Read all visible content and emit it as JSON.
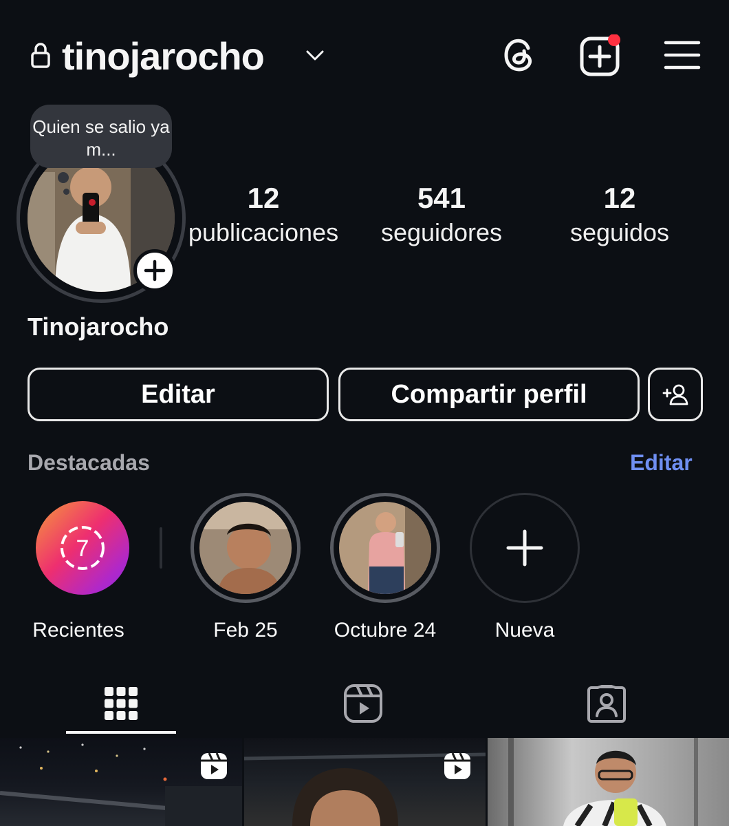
{
  "header": {
    "username": "tinojarocho",
    "icons": [
      "lock-icon",
      "chevron-down-icon",
      "threads-icon",
      "new-post-icon",
      "menu-icon"
    ],
    "notification_color": "#ff3040"
  },
  "profile": {
    "note": "Quien se salio ya m...",
    "display_name": "Tinojarocho",
    "stats": [
      {
        "value": "12",
        "label": "publicaciones"
      },
      {
        "value": "541",
        "label": "seguidores"
      },
      {
        "value": "12",
        "label": "seguidos"
      }
    ]
  },
  "buttons": {
    "edit": "Editar",
    "share": "Compartir perfil"
  },
  "highlights": {
    "title": "Destacadas",
    "edit_link": "Editar",
    "accent_color": "#6f8ff2",
    "items": [
      {
        "label": "Recientes",
        "badge": "7"
      },
      {
        "label": "Feb 25"
      },
      {
        "label": "Octubre 24"
      },
      {
        "label": "Nueva"
      }
    ]
  },
  "tabs": [
    {
      "name": "posts",
      "icon": "grid-icon",
      "selected": true
    },
    {
      "name": "reels",
      "icon": "reels-icon",
      "selected": false
    },
    {
      "name": "tagged",
      "icon": "tagged-icon",
      "selected": false
    }
  ]
}
